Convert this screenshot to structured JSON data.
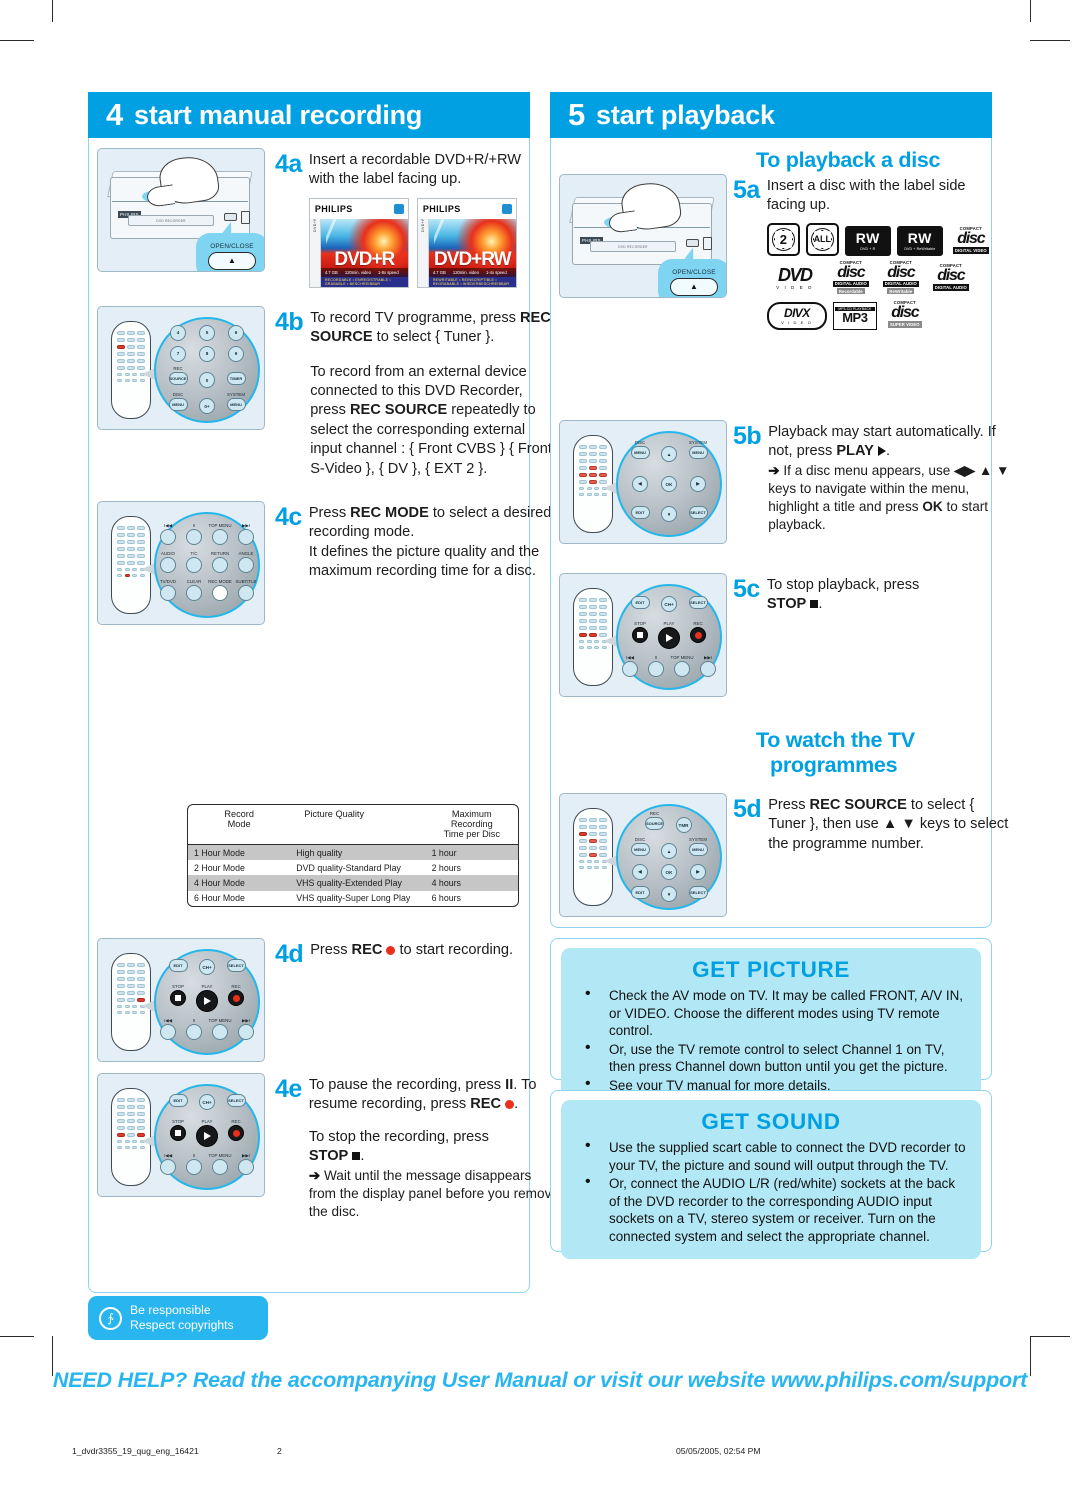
{
  "sections": {
    "left": {
      "num": "4",
      "title": "start manual recording"
    },
    "right": {
      "num": "5",
      "title": "start playback"
    }
  },
  "steps_left": [
    {
      "id": "4a",
      "text": "Insert a recordable DVD+R/+RW with the label facing up.",
      "figure": "dvd-recorder-open-close"
    },
    {
      "id": "4b",
      "p1_a": "To record TV programme, press ",
      "p1_b": "REC SOURCE",
      "p1_c": " to select { Tuner }.",
      "p2_a": "To record from an external device connected to this DVD Recorder, press ",
      "p2_b": "REC SOURCE",
      "p2_c": " repeatedly to select the corresponding external input channel : { Front CVBS } { Front S-Video }, { DV }, { EXT 2 }.",
      "figure": "remote-rec-source"
    },
    {
      "id": "4c",
      "p1_a": "Press ",
      "p1_b": "REC MODE",
      "p1_c": " to select a desired recording mode.",
      "p2": "It defines the picture quality and the maximum recording time for a disc.",
      "figure": "remote-rec-mode"
    },
    {
      "id": "4d",
      "p1_a": "Press ",
      "p1_b": "REC",
      "p1_c": " to start recording.",
      "figure": "remote-rec"
    },
    {
      "id": "4e",
      "p1_a": "To pause the recording, press ",
      "p1_b": "II",
      "p1_c": ". To resume recording, press ",
      "p1_d": "REC",
      "p1_e": ".",
      "p2_a": "To stop the recording, press ",
      "p2_b": "STOP",
      "p2_c": ".",
      "note": "Wait until the message disappears from the display panel before you remove the disc.",
      "figure": "remote-pause-stop"
    }
  ],
  "rec_mode_table": {
    "headers": [
      "Record Mode",
      "Picture Quality",
      "Maximum Recording Time per Disc"
    ],
    "header_lines": [
      [
        "Record",
        "Mode"
      ],
      [
        "Picture Quality",
        ""
      ],
      [
        "Maximum Recording",
        "Time per Disc"
      ]
    ],
    "rows": [
      [
        "1 Hour Mode",
        "High quality",
        "1 hour"
      ],
      [
        "2 Hour Mode",
        "DVD quality-Standard Play",
        "2 hours"
      ],
      [
        "4 Hour Mode",
        "VHS quality-Extended Play",
        "4 hours"
      ],
      [
        "6 Hour Mode",
        "VHS quality-Super Long Play",
        "6 hours"
      ]
    ]
  },
  "discs": [
    {
      "brand": "PHILIPS",
      "title": "DVD+R",
      "spine": "DVD+R 4.7GB",
      "foot": [
        "4.7 GB",
        "120min. video",
        "1-8x  speed"
      ],
      "foot2": "RECORDABLE • ENREGISTRABLE • GRABABLE • BESCHREIBBAR"
    },
    {
      "brand": "PHILIPS",
      "title": "DVD+RW",
      "spine": "DVD+RW 4.7GB",
      "foot": [
        "4.7 GB",
        "120min. video",
        "1-4x  speed"
      ],
      "foot2": "REWRITABLE • REINSCRIPTIBLE • REGRABABLE • WIEDERBESCHREIBBAR"
    }
  ],
  "right_panel": {
    "to_playback_title": "To playback a disc",
    "to_watch_title_line1": "To watch the TV",
    "to_watch_title_line2": "programmes"
  },
  "steps_right": [
    {
      "id": "5a",
      "text": "Insert a disc with the label side facing up.",
      "figure": "dvd-recorder-open-close"
    },
    {
      "id": "5b",
      "p1_a": "Playback may start automatically. If not, press ",
      "p1_b": "PLAY",
      "p1_c": ".",
      "note_a": "If a disc menu appears, use ",
      "note_b": "◀▶ ▲ ▼",
      "note_c": " keys to navigate within the menu, highlight a title and press ",
      "note_d": "OK",
      "note_e": " to start playback.",
      "figure": "remote-navigation"
    },
    {
      "id": "5c",
      "p1_a": "To stop playback, press ",
      "p1_b": "STOP",
      "p1_c": ".",
      "figure": "remote-stop"
    },
    {
      "id": "5d",
      "p1_a": "Press ",
      "p1_b": "REC SOURCE",
      "p1_c": " to select { Tuner }, then use ",
      "p1_d": "▲ ▼",
      "p1_e": " keys to select the programme number.",
      "figure": "remote-tuner"
    }
  ],
  "disc_logos": [
    [
      {
        "name": "region-2-icon",
        "kind": "region",
        "label": "2"
      },
      {
        "name": "region-all-icon",
        "kind": "region",
        "label": "ALL"
      },
      {
        "name": "dvd-plus-r-icon",
        "kind": "rw",
        "top": "RW",
        "sub": "DVD + R"
      },
      {
        "name": "dvd-plus-rewritable-icon",
        "kind": "rw",
        "top": "RW",
        "sub": "DVD + ReWritable"
      },
      {
        "name": "compact-disc-digital-video-icon",
        "kind": "cd",
        "top": "COMPACT",
        "mid": "disc",
        "bot": "DIGITAL VIDEO"
      }
    ],
    [
      {
        "name": "dvd-video-icon",
        "kind": "dvd",
        "top": "DVD",
        "sub": "V I D E O"
      },
      {
        "name": "cd-recordable-icon",
        "kind": "cd",
        "top": "COMPACT",
        "mid": "disc",
        "bot": "DIGITAL AUDIO",
        "bot2": "Recordable"
      },
      {
        "name": "cd-rewritable-icon",
        "kind": "cd",
        "top": "COMPACT",
        "mid": "disc",
        "bot": "DIGITAL AUDIO",
        "bot2": "ReWritable"
      },
      {
        "name": "cd-digital-audio-icon",
        "kind": "cd",
        "top": "COMPACT",
        "mid": "disc",
        "bot": "DIGITAL AUDIO"
      }
    ],
    [
      {
        "name": "divx-video-icon",
        "kind": "divx",
        "top": "DIVX",
        "sub": "V I D E O"
      },
      {
        "name": "mp3-cd-playback-icon",
        "kind": "mp3",
        "top": "MP3-CD PLAYBACK",
        "mid": "MP3"
      },
      {
        "name": "super-video-cd-icon",
        "kind": "cd",
        "top": "COMPACT",
        "mid": "disc",
        "bot": "SUPER VIDEO"
      }
    ]
  ],
  "get_picture": {
    "title": "GET PICTURE",
    "bullets": [
      "Check the AV mode on TV.  It may be called FRONT, A/V IN, or VIDEO.  Choose the different modes using TV remote control.",
      "Or, use the TV remote control to select Channel 1 on TV, then press Channel down button until you get the picture.",
      "See your TV manual for more details."
    ]
  },
  "get_sound": {
    "title": "GET SOUND",
    "bullets": [
      "Use the supplied scart cable to connect the DVD recorder to your TV, the picture and sound will output through the TV.",
      "Or, connect the AUDIO L/R (red/white) sockets at the back of the DVD recorder to the corresponding AUDIO input sockets on a TV, stereo system or receiver. Turn on the connected system and select the appropriate channel."
    ]
  },
  "responsible_badge": {
    "line1": "Be responsible",
    "line2": "Respect copyrights"
  },
  "need_help": "NEED HELP?  Read the accompanying User Manual or visit our website www.philips.com/support",
  "footer": {
    "file": "1_dvdr3355_19_qug_eng_16421",
    "page": "2",
    "timestamp": "05/05/2005, 02:54 PM"
  },
  "device_labels": {
    "open_close": "OPEN/CLOSE",
    "eject_glyph": "▲",
    "tray_text": "DVD RECORDER"
  },
  "remote_keypads": {
    "rec_source": {
      "rows": [
        [
          "7",
          "8",
          "9"
        ],
        [
          "REC SOURCE",
          "0",
          "TIMER"
        ],
        [
          "DISC MENU",
          "0+",
          "SYSTEM MENU"
        ]
      ],
      "top": "5"
    },
    "rec_mode": {
      "rows": [
        [
          "I◀◀",
          "II",
          "TOP MENU",
          "▶▶I"
        ],
        [
          "AUDIO",
          "T/C",
          "RETURN",
          "ANGLE"
        ],
        [
          "TV/DVD",
          "CLEAR",
          "REC MODE",
          "SUBTITLE"
        ]
      ]
    },
    "rec": {
      "rows": [
        [
          "EDIT",
          "CH+",
          "SELECT"
        ],
        [
          "STOP",
          "PLAY",
          "REC"
        ],
        [
          "I◀◀",
          "II",
          "TOP MENU",
          "▶▶I"
        ]
      ]
    },
    "nav": {
      "rows": [
        [
          "DISC MENU",
          "▲",
          "SYSTEM MENU"
        ],
        [
          "◀",
          "OK",
          "▶"
        ],
        [
          "EDIT",
          "▼",
          "SELECT"
        ]
      ]
    }
  },
  "colors": {
    "brand_blue": "#00a0e3",
    "light_blue": "#b2e8f5",
    "panel_border": "#8fd4f0",
    "record_red": "#e8301c"
  }
}
